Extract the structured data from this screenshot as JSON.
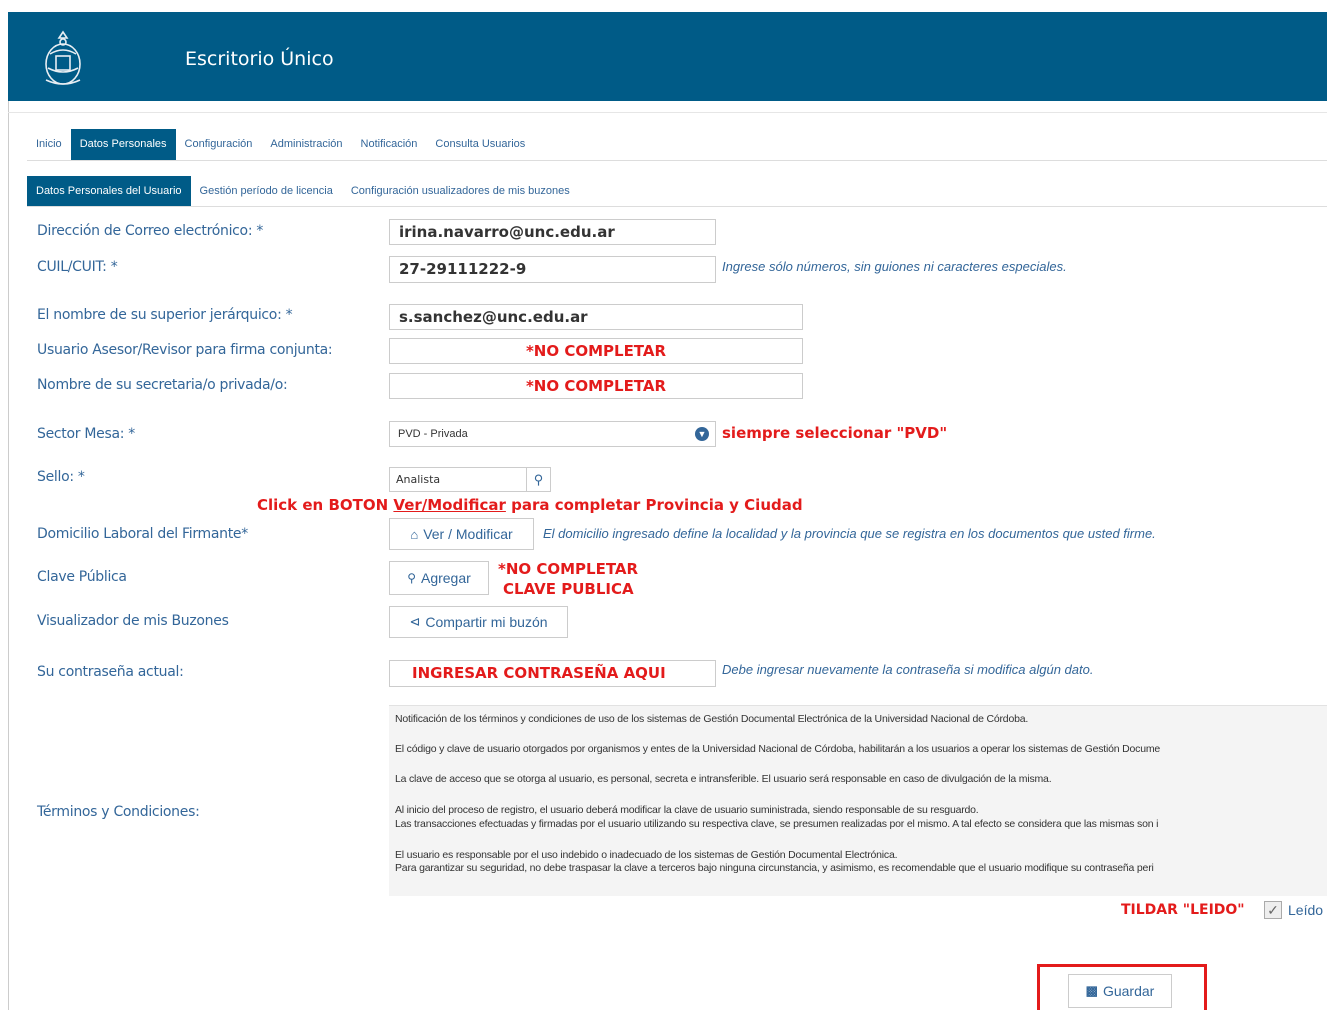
{
  "app": {
    "title": "Escritorio Único"
  },
  "nav_main": [
    {
      "label": "Inicio",
      "active": false
    },
    {
      "label": "Datos Personales",
      "active": true
    },
    {
      "label": "Configuración",
      "active": false
    },
    {
      "label": "Administración",
      "active": false
    },
    {
      "label": "Notificación",
      "active": false
    },
    {
      "label": "Consulta Usuarios",
      "active": false
    }
  ],
  "nav_sub": [
    {
      "label": "Datos Personales del Usuario",
      "active": true
    },
    {
      "label": "Gestión período de licencia",
      "active": false
    },
    {
      "label": "Configuración usualizadores de mis buzones",
      "active": false
    }
  ],
  "form": {
    "email_label": "Dirección de Correo electrónico: *",
    "email_value": "irina.navarro@unc.edu.ar",
    "cuil_label": "CUIL/CUIT: *",
    "cuil_value": "27-29111222-9",
    "cuil_hint": "Ingrese sólo números, sin guiones ni caracteres especiales.",
    "superior_label": "El nombre de su superior jerárquico: *",
    "superior_value": "s.sanchez@unc.edu.ar",
    "asesor_label": "Usuario Asesor/Revisor para firma conjunta:",
    "asesor_value": "*NO COMPLETAR",
    "secretaria_label": "Nombre de su secretaria/o privada/o:",
    "secretaria_value": "*NO COMPLETAR",
    "sector_label": "Sector Mesa: *",
    "sector_value": "PVD - Privada",
    "sector_note": "siempre seleccionar \"PVD\"",
    "sello_label": "Sello: *",
    "sello_value": "Analista",
    "click_note_prefix": "Click en BOTON ",
    "click_note_link": "Ver/Modificar",
    "click_note_suffix": " para completar Provincia y Ciudad",
    "domicilio_label": "Domicilio Laboral del Firmante*",
    "domicilio_button": "Ver / Modificar",
    "domicilio_hint": "El domicilio ingresado define la localidad y la provincia que se registra en los documentos que usted firme.",
    "clave_label": "Clave Pública",
    "clave_button": "Agregar",
    "clave_note_1": "*NO COMPLETAR",
    "clave_note_2": "CLAVE PUBLICA",
    "visualizador_label": "Visualizador de mis Buzones",
    "visualizador_button": "Compartir mi buzón",
    "password_label": "Su contraseña actual:",
    "password_value": "INGRESAR CONTRASEÑA AQUI",
    "password_hint": "Debe ingresar nuevamente la contraseña si modifica algún dato.",
    "terms_label": "Términos y Condiciones:",
    "terms_lines": [
      "Notificación de los términos y condiciones de uso de los sistemas de Gestión Documental Electrónica de la Universidad Nacional de Córdoba.",
      "El código y clave de usuario otorgados por organismos y entes de la Universidad Nacional de Córdoba, habilitarán a los usuarios a operar los sistemas de Gestión Docume",
      "La clave de acceso que se otorga al usuario, es personal, secreta e intransferible. El usuario será responsable en caso de divulgación de la misma.",
      "Al inicio del proceso de registro, el usuario deberá modificar la clave de usuario suministrada, siendo responsable de su resguardo.",
      "Las transacciones efectuadas y firmadas por el usuario utilizando su respectiva clave, se presumen realizadas por el mismo. A tal efecto se considera que las mismas son i",
      "El usuario es responsable por el uso indebido o inadecuado de los sistemas de Gestión Documental Electrónica.",
      "Para garantizar su seguridad, no debe traspasar la clave a terceros bajo ninguna circunstancia, y asimismo, es recomendable que el usuario modifique su contraseña peri"
    ],
    "leido_note": "TILDAR \"LEIDO\"",
    "leido_label": "Leído",
    "save_button": "Guardar"
  },
  "colors": {
    "header": "#005b87",
    "accent_red": "#e31b1b",
    "label": "#336699"
  }
}
